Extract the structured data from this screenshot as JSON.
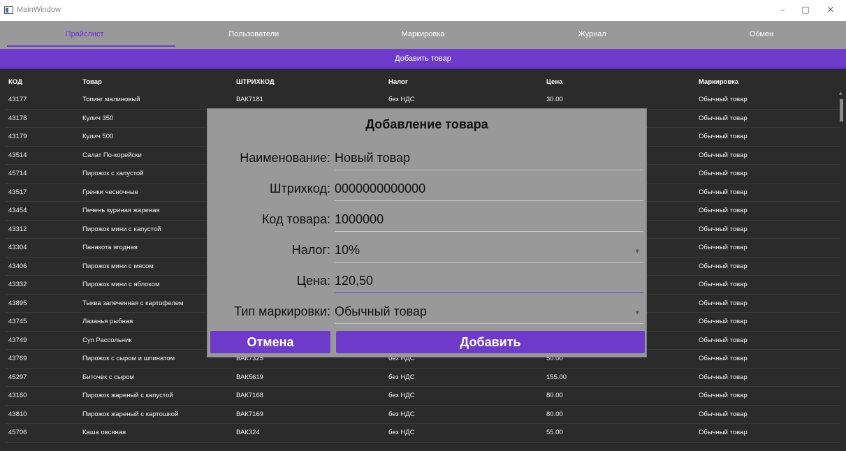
{
  "window": {
    "title": "MainWindow",
    "minimize": "–",
    "maximize": "▢",
    "close": "✕"
  },
  "tabs": [
    {
      "label": "Прайслист"
    },
    {
      "label": "Пользователи"
    },
    {
      "label": "Маркировка"
    },
    {
      "label": "Журнал"
    },
    {
      "label": "Обмен"
    }
  ],
  "add_bar": {
    "label": "Добавить товар"
  },
  "table": {
    "columns": [
      "КОД",
      "Товар",
      "ШТРИХКОД",
      "Налог",
      "Цена",
      "Маркировка"
    ],
    "rows": [
      [
        "43177",
        "Топинг малиновый",
        "ВАК7181",
        "без НДС",
        "30.00",
        "Обычный товар"
      ],
      [
        "43178",
        "Кулич 350",
        "",
        "",
        "",
        "Обычный товар"
      ],
      [
        "43179",
        "Кулич 500",
        "",
        "",
        "",
        "Обычный товар"
      ],
      [
        "43514",
        "Салат По-корейски",
        "",
        "",
        "",
        "Обычный товар"
      ],
      [
        "45714",
        "Пирожок с капустой",
        "",
        "",
        "",
        "Обычный товар"
      ],
      [
        "43517",
        "Гренки чесночные",
        "",
        "",
        "",
        "Обычный товар"
      ],
      [
        "43454",
        "Печень куриная жареная",
        "",
        "",
        "",
        "Обычный товар"
      ],
      [
        "43312",
        "Пирожок мини с капустой",
        "",
        "",
        "",
        "Обычный товар"
      ],
      [
        "43304",
        "Панакота ягодная",
        "",
        "",
        "",
        "Обычный товар"
      ],
      [
        "43406",
        "Пирожок мини с мясом",
        "",
        "",
        "",
        "Обычный товар"
      ],
      [
        "43332",
        "Пирожок мини с яблоком",
        "",
        "",
        "",
        "Обычный товар"
      ],
      [
        "43895",
        "Тыква запеченная с картофелем",
        "",
        "",
        "",
        "Обычный товар"
      ],
      [
        "43745",
        "Лазанья рыбная",
        "",
        "",
        "",
        "Обычный товар"
      ],
      [
        "43749",
        "Суп Рассольник",
        "",
        "",
        "",
        "Обычный товар"
      ],
      [
        "43769",
        "Пирожок с сыром и шпинатом",
        "ВАК7325",
        "без НДС",
        "50.00",
        "Обычный товар"
      ],
      [
        "45297",
        "Биточек с сыром",
        "ВАК5619",
        "без НДС",
        "155.00",
        "Обычный товар"
      ],
      [
        "43160",
        "Пирожок жареный с капустой",
        "ВАК7168",
        "без НДС",
        "80.00",
        "Обычный товар"
      ],
      [
        "43810",
        "Пирожок жареный с картошкой",
        "ВАК7169",
        "без НДС",
        "80.00",
        "Обычный товар"
      ],
      [
        "45706",
        "Каша овсяная",
        "ВАК324",
        "без НДС",
        "55.00",
        "Обычный товар"
      ]
    ]
  },
  "dialog": {
    "title": "Добавление товара",
    "fields": [
      {
        "label": "Наименование:",
        "value": "Новый товар"
      },
      {
        "label": "Штрихкод:",
        "value": "0000000000000"
      },
      {
        "label": "Код товара:",
        "value": "1000000"
      },
      {
        "label": "Налог:",
        "value": "10%"
      },
      {
        "label": "Цена:",
        "value": "120,50"
      },
      {
        "label": "Тип маркировки:",
        "value": "Обычный товар"
      }
    ],
    "cancel_label": "Отмена",
    "add_label": "Добавить"
  },
  "colors": {
    "accent": "#6d3ac9",
    "tab_bar": "#999999",
    "background": "#2b2b2b"
  }
}
